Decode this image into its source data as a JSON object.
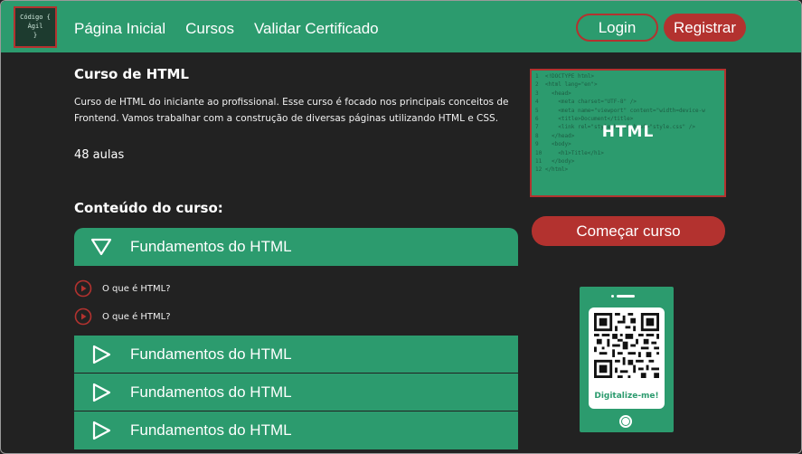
{
  "header": {
    "logo_lines": [
      "Código {",
      "Ágil",
      "}"
    ],
    "nav": [
      "Página Inicial",
      "Cursos",
      "Validar Certificado"
    ],
    "login_label": "Login",
    "register_label": "Registrar"
  },
  "course": {
    "title": "Curso de HTML",
    "description": "Curso de HTML do iniciante ao profissional. Esse curso é focado nos principais conceitos de Frontend. Vamos trabalhar com a construção de diversas páginas utilizando HTML e CSS.",
    "lessons_count": "48 aulas",
    "thumbnail_label": "HTML",
    "start_button": "Começar curso"
  },
  "content": {
    "heading": "Conteúdo do curso:",
    "modules": [
      {
        "label": "Fundamentos do HTML",
        "expanded": true,
        "lessons": [
          "O que é HTML?",
          "O que é HTML?"
        ]
      },
      {
        "label": "Fundamentos do HTML",
        "expanded": false
      },
      {
        "label": "Fundamentos do HTML",
        "expanded": false
      },
      {
        "label": "Fundamentos do HTML",
        "expanded": false
      }
    ]
  },
  "qr": {
    "caption": "Digitalize-me!"
  },
  "colors": {
    "brand_green": "#2c9b6e",
    "accent_red": "#b3322f",
    "background": "#222222"
  },
  "icons": {
    "expanded": "triangle-down-icon",
    "collapsed": "triangle-right-icon",
    "lesson": "play-circle-icon"
  }
}
